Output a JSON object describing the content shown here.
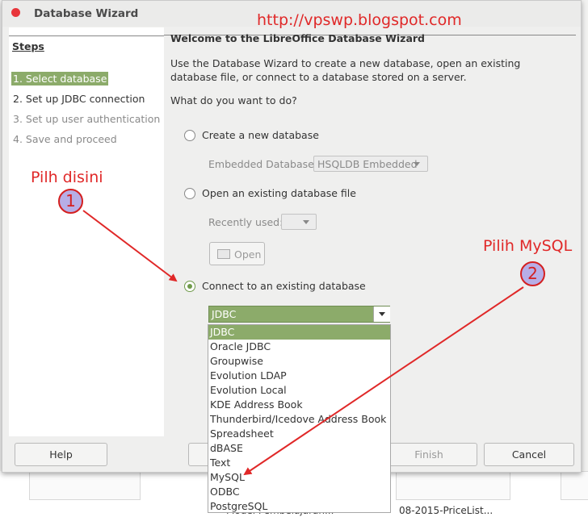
{
  "window": {
    "title": "Database Wizard"
  },
  "watermark": "http://vpswp.blogspot.com",
  "steps": {
    "heading": "Steps",
    "items": [
      {
        "label": "1. Select database",
        "state": "active"
      },
      {
        "label": "2. Set up JDBC connection",
        "state": "normal"
      },
      {
        "label": "3. Set up user authentication",
        "state": "disabled"
      },
      {
        "label": "4. Save and proceed",
        "state": "disabled"
      }
    ]
  },
  "main": {
    "heading": "Welcome to the LibreOffice Database Wizard",
    "description": "Use the Database Wizard to create a new database, open an existing database file, or connect to a database stored on a server.",
    "question": "What do you want to do?",
    "option_new": "Create a new database",
    "embedded_label": "Embedded Database:",
    "embedded_value": "HSQLDB Embedded",
    "option_open": "Open an existing database file",
    "recent_label": "Recently used:",
    "open_button": "Open",
    "option_connect": "Connect to an existing database",
    "selected_option": "connect"
  },
  "dropdown": {
    "selected": "JDBC",
    "options": [
      "JDBC",
      "Oracle JDBC",
      "Groupwise",
      "Evolution LDAP",
      "Evolution Local",
      "KDE Address Book",
      "Thunderbird/Icedove Address Book",
      "Spreadsheet",
      "dBASE",
      "Text",
      "MySQL",
      "ODBC",
      "PostgreSQL"
    ]
  },
  "buttons": {
    "help": "Help",
    "finish": "Finish",
    "cancel": "Cancel"
  },
  "annotations": {
    "note1": "Pilh disini",
    "badge1": "1",
    "note2": "Pilih MySQL",
    "badge2": "2"
  },
  "background": {
    "file_label_left": "Model Pembelajaran...",
    "file_label_right": "08-2015-PriceList..."
  },
  "colors": {
    "accent_green": "#8cab6a",
    "annotation_red": "#e02828",
    "badge_fill": "#b7aee6"
  }
}
